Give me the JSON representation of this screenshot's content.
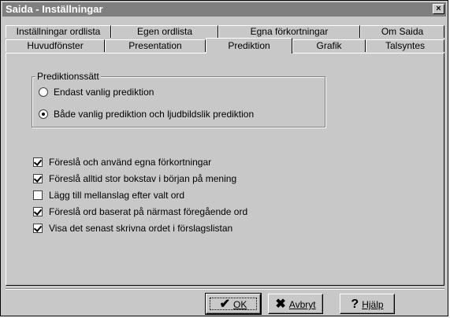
{
  "window": {
    "title": "Saida - Inställningar",
    "close_label": "×"
  },
  "tabs_row1": [
    {
      "label": "Inställningar ordlista"
    },
    {
      "label": "Egen ordlista"
    },
    {
      "label": "Egna förkortningar"
    },
    {
      "label": "Om Saida"
    }
  ],
  "tabs_row2": [
    {
      "label": "Huvudfönster"
    },
    {
      "label": "Presentation"
    },
    {
      "label": "Prediktion",
      "active": true
    },
    {
      "label": "Grafik"
    },
    {
      "label": "Talsyntes"
    }
  ],
  "prediction_group": {
    "legend": "Prediktionssätt",
    "options": [
      {
        "label": "Endast vanlig prediktion",
        "selected": false
      },
      {
        "label": "Både vanlig prediktion och ljudbildslik prediktion",
        "selected": true
      }
    ]
  },
  "checkboxes": [
    {
      "label": "Föreslå och använd egna förkortningar",
      "checked": true
    },
    {
      "label": "Föreslå alltid stor bokstav i början på mening",
      "checked": true
    },
    {
      "label": "Lägg till mellanslag efter valt ord",
      "checked": false
    },
    {
      "label": "Föreslå ord baserat på närmast föregående ord",
      "checked": true
    },
    {
      "label": "Visa det senast skrivna ordet i förslagslistan",
      "checked": true
    }
  ],
  "buttons": {
    "ok": {
      "label": "OK",
      "icon": "check-icon"
    },
    "cancel": {
      "label": "Avbryt",
      "icon": "x-icon"
    },
    "help": {
      "label": "Hjälp",
      "icon": "question-icon"
    }
  }
}
